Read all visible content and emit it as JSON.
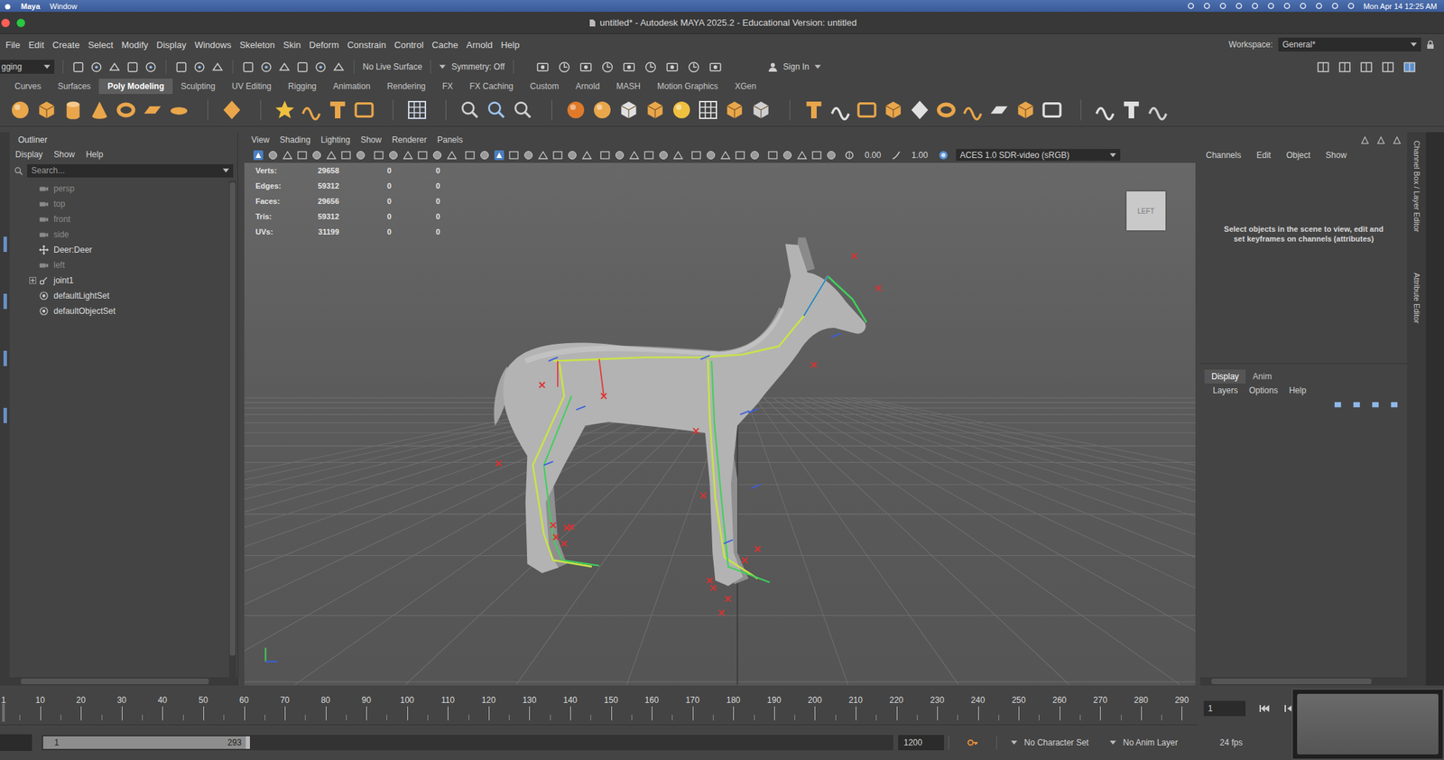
{
  "mac_menubar": {
    "items": [
      "Maya",
      "Window"
    ],
    "clock": "Mon Apr 14 12:25 AM"
  },
  "window": {
    "title": "untitled* - Autodesk MAYA 2025.2 - Educational Version: untitled"
  },
  "menubar": {
    "items": [
      "File",
      "Edit",
      "Create",
      "Select",
      "Modify",
      "Display",
      "Windows",
      "Skeleton",
      "Skin",
      "Deform",
      "Constrain",
      "Control",
      "Cache",
      "Arnold",
      "Help"
    ],
    "workspace_label": "Workspace:",
    "workspace": "General*"
  },
  "status_line": {
    "menu_set": "gging",
    "live_surface": "No Live Surface",
    "symmetry": "Symmetry: Off",
    "sign_in": "Sign In"
  },
  "shelf": {
    "tabs": [
      {
        "label": "Curves",
        "selected": false
      },
      {
        "label": "Surfaces",
        "selected": false
      },
      {
        "label": "Poly Modeling",
        "selected": true
      },
      {
        "label": "Sculpting",
        "selected": false
      },
      {
        "label": "UV Editing",
        "selected": false
      },
      {
        "label": "Rigging",
        "selected": false
      },
      {
        "label": "Animation",
        "selected": false
      },
      {
        "label": "Rendering",
        "selected": false
      },
      {
        "label": "FX",
        "selected": false
      },
      {
        "label": "FX Caching",
        "selected": false
      },
      {
        "label": "Custom",
        "selected": false
      },
      {
        "label": "Arnold",
        "selected": false
      },
      {
        "label": "MASH",
        "selected": false
      },
      {
        "label": "Motion Graphics",
        "selected": false
      },
      {
        "label": "XGen",
        "selected": false
      }
    ]
  },
  "outliner": {
    "title": "Outliner",
    "menu": [
      "Display",
      "Show",
      "Help"
    ],
    "search_placeholder": "Search...",
    "items": [
      {
        "label": "persp",
        "kind": "camera",
        "dimmed": true,
        "expandable": false,
        "expanded": false
      },
      {
        "label": "top",
        "kind": "camera",
        "dimmed": true,
        "expandable": false,
        "expanded": false
      },
      {
        "label": "front",
        "kind": "camera",
        "dimmed": true,
        "expandable": false,
        "expanded": false
      },
      {
        "label": "side",
        "kind": "camera",
        "dimmed": true,
        "expandable": false,
        "expanded": false
      },
      {
        "label": "Deer:Deer",
        "kind": "transform",
        "dimmed": false,
        "expandable": false,
        "expanded": false
      },
      {
        "label": "left",
        "kind": "camera",
        "dimmed": true,
        "expandable": false,
        "expanded": false
      },
      {
        "label": "joint1",
        "kind": "joint",
        "dimmed": false,
        "expandable": true,
        "expanded": false
      },
      {
        "label": "defaultLightSet",
        "kind": "set",
        "dimmed": false,
        "expandable": false,
        "expanded": false
      },
      {
        "label": "defaultObjectSet",
        "kind": "set",
        "dimmed": false,
        "expandable": false,
        "expanded": false
      }
    ]
  },
  "viewport": {
    "menu": [
      "View",
      "Shading",
      "Lighting",
      "Show",
      "Renderer",
      "Panels"
    ],
    "exposure": "0.00",
    "gamma": "1.00",
    "color_space": "ACES 1.0 SDR-video (sRGB)",
    "hud": [
      {
        "label": "Verts:",
        "values": [
          "29658",
          "0",
          "0"
        ]
      },
      {
        "label": "Edges:",
        "values": [
          "59312",
          "0",
          "0"
        ]
      },
      {
        "label": "Faces:",
        "values": [
          "29656",
          "0",
          "0"
        ]
      },
      {
        "label": "Tris:",
        "values": [
          "59312",
          "0",
          "0"
        ]
      },
      {
        "label": "UVs:",
        "values": [
          "31199",
          "0",
          "0"
        ]
      }
    ],
    "view_cube": "LEFT"
  },
  "channel_box": {
    "menu": [
      "Channels",
      "Edit",
      "Object",
      "Show"
    ],
    "message": "Select objects in the scene to view, edit and set keyframes on channels (attributes)",
    "layer_tabs": [
      {
        "label": "Display",
        "selected": true
      },
      {
        "label": "Anim",
        "selected": false
      }
    ],
    "layer_menu": [
      "Layers",
      "Options",
      "Help"
    ],
    "side_tabs": [
      "Channel Box / Layer Editor",
      "Attribute Editor"
    ]
  },
  "time_slider": {
    "ticks": [
      "1",
      "10",
      "20",
      "30",
      "40",
      "50",
      "60",
      "70",
      "80",
      "90",
      "100",
      "110",
      "120",
      "130",
      "140",
      "150",
      "160",
      "170",
      "180",
      "190",
      "200",
      "210",
      "220",
      "230",
      "240",
      "250",
      "260",
      "270",
      "280",
      "290"
    ],
    "current_frame": "1"
  },
  "range_slider": {
    "range_start": "1",
    "range_end": "293",
    "end": "1200",
    "character_set": "No Character Set",
    "anim_layer": "No Anim Layer",
    "fps": "24 fps"
  }
}
